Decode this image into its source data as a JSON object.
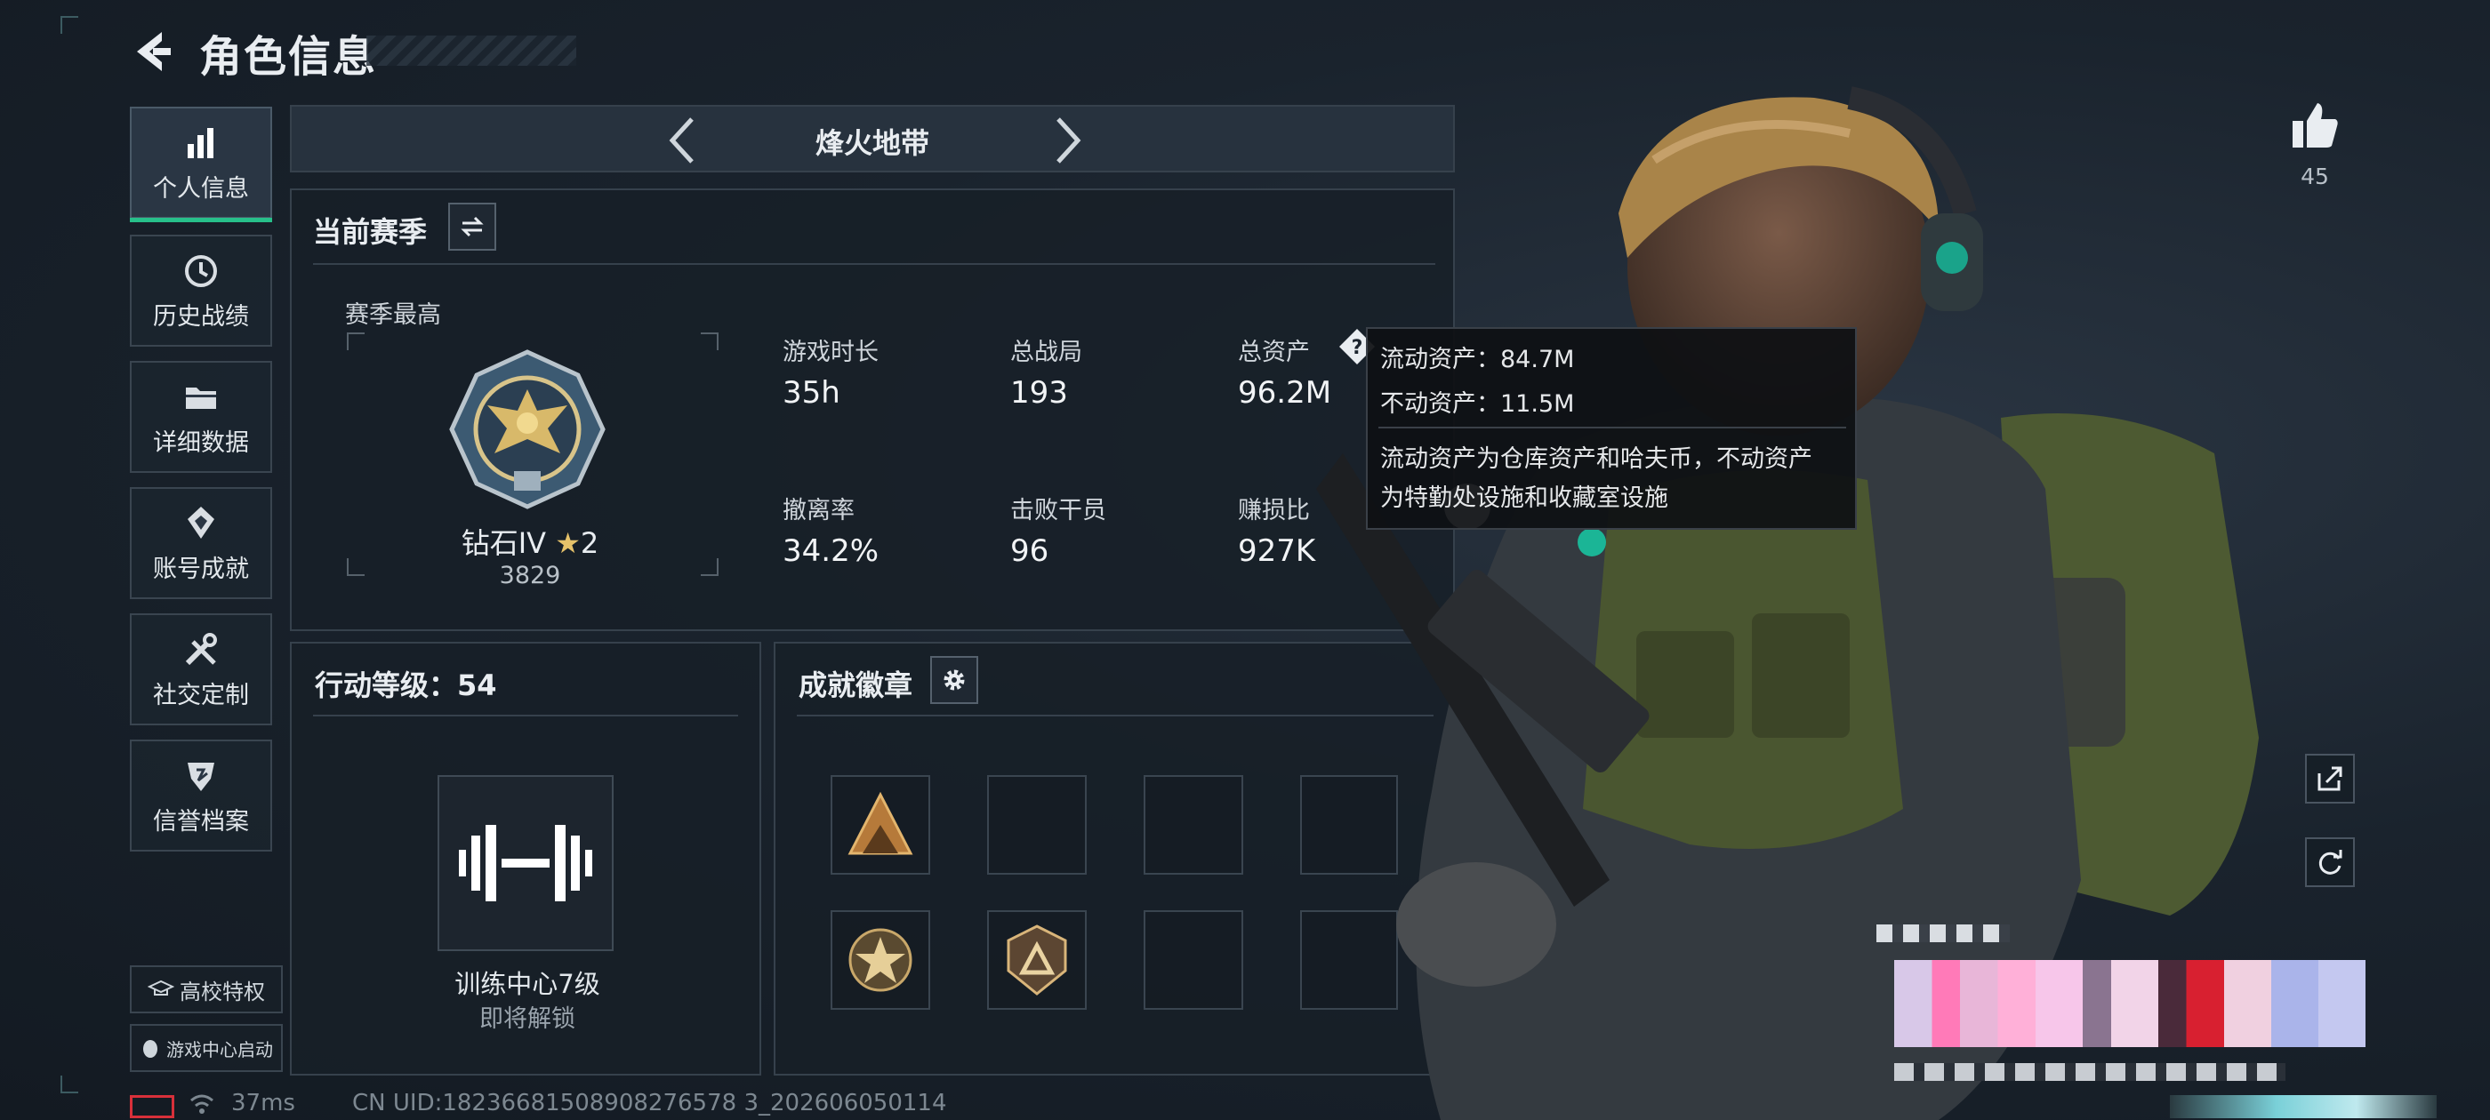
{
  "header": {
    "title": "角色信息"
  },
  "sidebar": {
    "items": [
      {
        "label": "个人信息",
        "icon": "bar-chart-icon",
        "active": true
      },
      {
        "label": "历史战绩",
        "icon": "history-icon"
      },
      {
        "label": "详细数据",
        "icon": "folder-icon"
      },
      {
        "label": "账号成就",
        "icon": "achievement-icon"
      },
      {
        "label": "社交定制",
        "icon": "tools-icon"
      },
      {
        "label": "信誉档案",
        "icon": "shield-icon"
      }
    ],
    "campus_label": "高校特权",
    "game_center_label": "游戏中心启动"
  },
  "mode": {
    "name": "烽火地带"
  },
  "season": {
    "title": "当前赛季",
    "best_label": "赛季最高",
    "rank_name": "钻石IV",
    "rank_stars": "2",
    "rank_score": "3829",
    "stats": [
      {
        "label": "游戏时长",
        "value": "35h"
      },
      {
        "label": "总战局",
        "value": "193"
      },
      {
        "label": "总资产",
        "value": "96.2M"
      },
      {
        "label": "撤离率",
        "value": "34.2%"
      },
      {
        "label": "击败干员",
        "value": "96"
      },
      {
        "label": "赚损比",
        "value": "927K"
      }
    ]
  },
  "tooltip": {
    "liquid": "流动资产：84.7M",
    "fixed": "不动资产：11.5M",
    "desc_line1": "流动资产为仓库资产和哈夫币，不动资产",
    "desc_line2": "为特勤处设施和收藏室设施"
  },
  "action_level": {
    "title": "行动等级：54",
    "training_name": "训练中心7级",
    "training_status": "即将解锁"
  },
  "badges": {
    "title": "成就徽章"
  },
  "likes": {
    "count": "45"
  },
  "status": {
    "ping": "37ms",
    "uid": "CN UID:18236681508908276578 3_202606050114"
  },
  "colors": {
    "accent": "#27c08a",
    "panel": "#1b242e",
    "background": "#17202a"
  }
}
